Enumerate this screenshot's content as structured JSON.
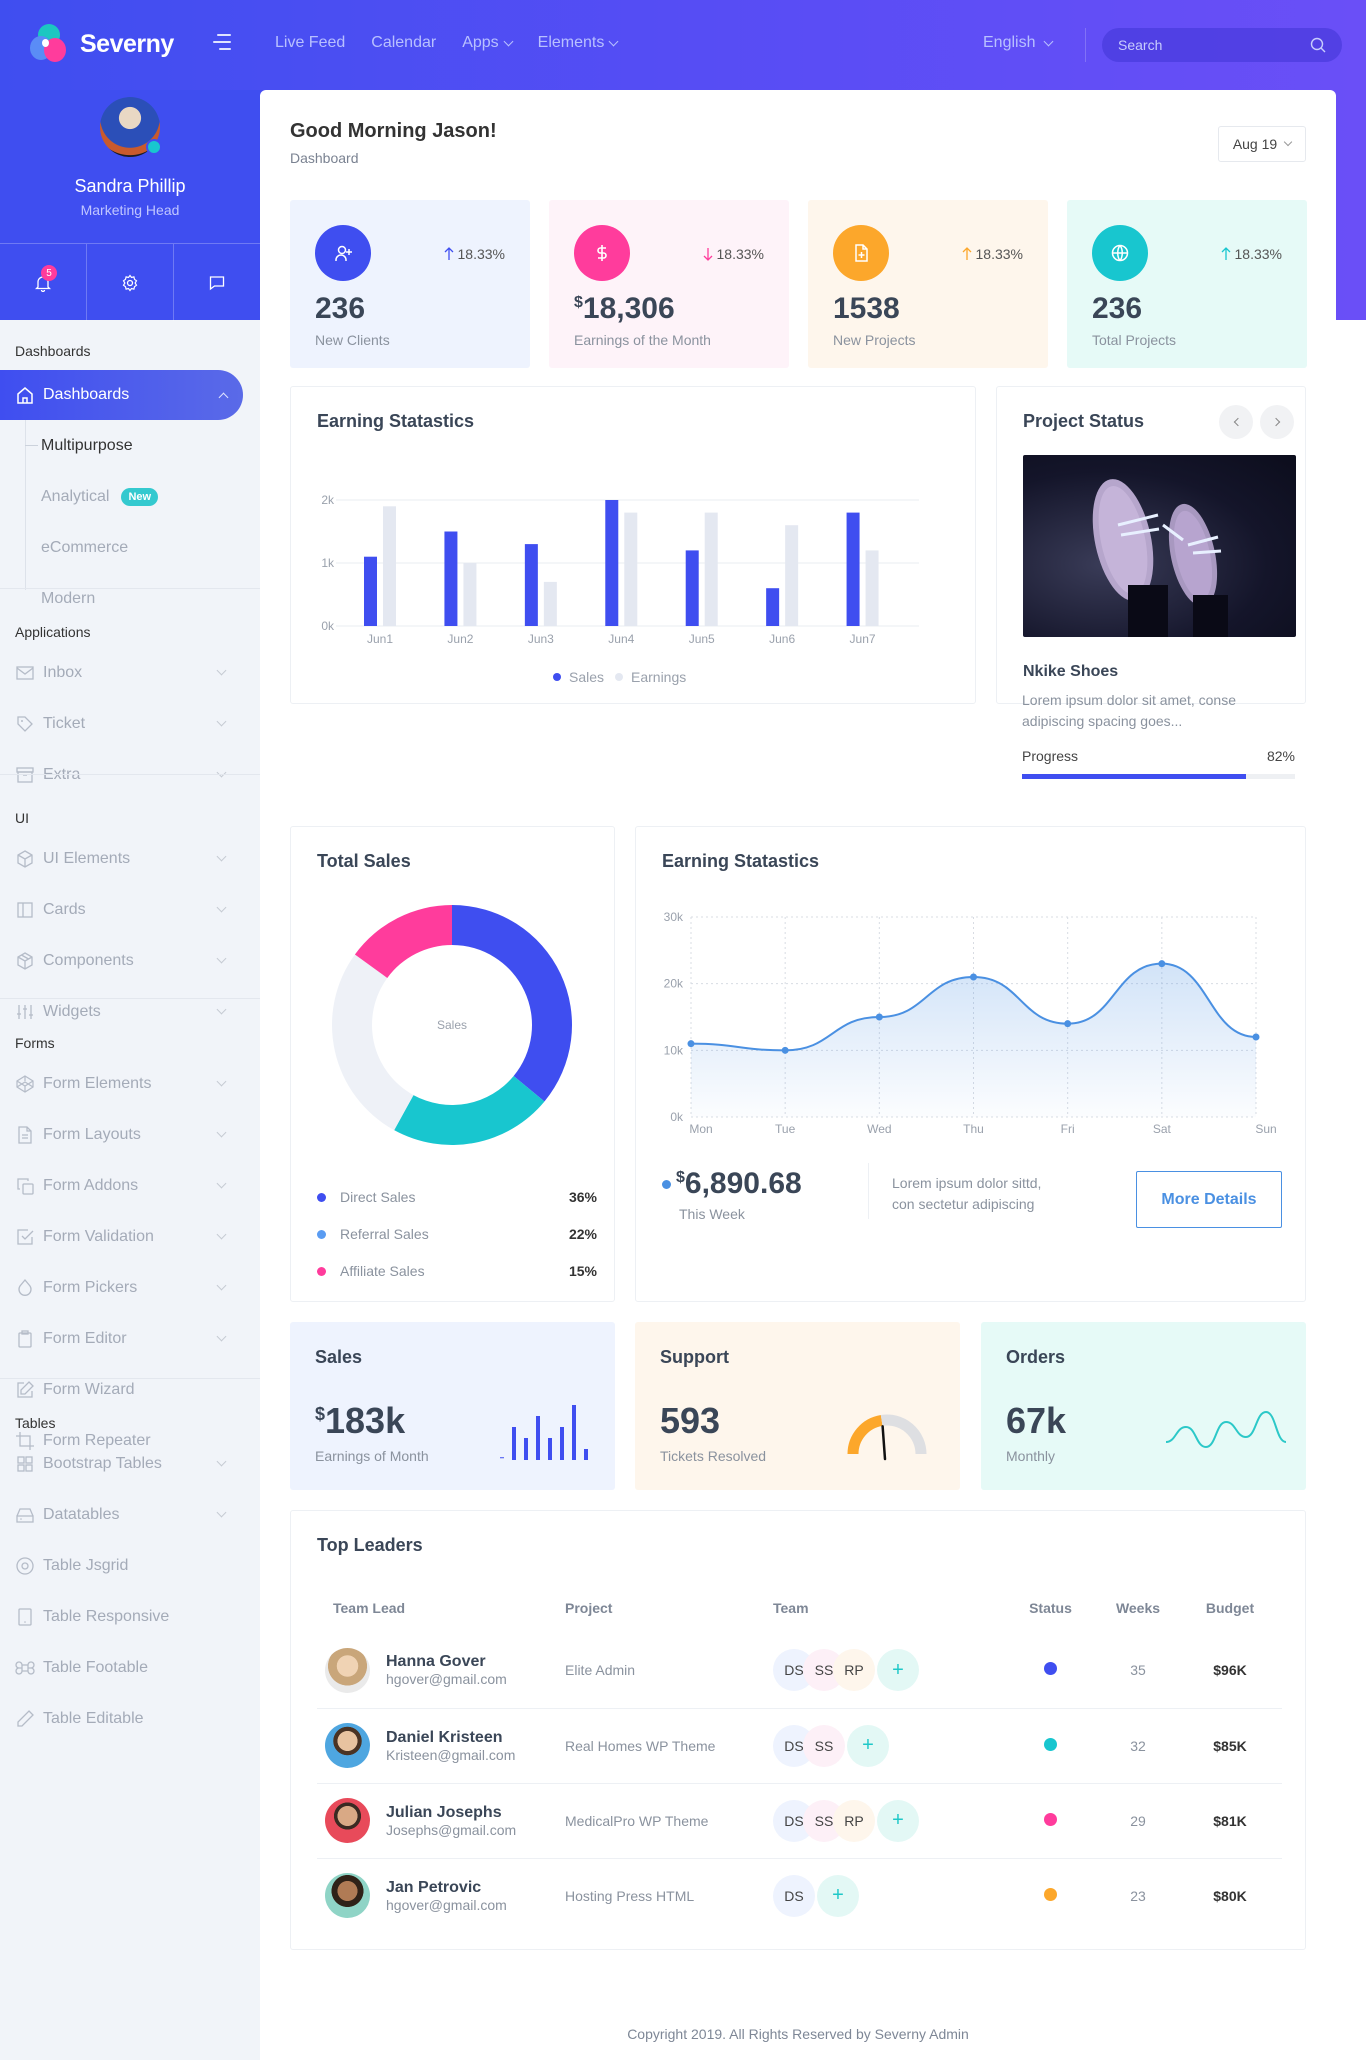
{
  "brand": {
    "name": "Severny",
    "colors": {
      "primary": "#3f4ef0",
      "pink": "#ff3c9c",
      "orange": "#fca72b",
      "teal": "#18c6cf",
      "blue": "#4a90e2"
    }
  },
  "topnav": {
    "items": [
      {
        "label": "Live Feed",
        "dropdown": false
      },
      {
        "label": "Calendar",
        "dropdown": false
      },
      {
        "label": "Apps",
        "dropdown": true
      },
      {
        "label": "Elements",
        "dropdown": true
      }
    ],
    "language": "English",
    "search_placeholder": "Search"
  },
  "profile": {
    "name": "Sandra Phillip",
    "role": "Marketing Head",
    "notifications": "5"
  },
  "sidebar": {
    "dashboards": {
      "title": "Dashboards",
      "active": "Dashboards",
      "sub": [
        {
          "label": "Multipurpose",
          "active": true
        },
        {
          "label": "Analytical",
          "badge": "New"
        },
        {
          "label": "eCommerce"
        },
        {
          "label": "Modern"
        }
      ]
    },
    "applications": {
      "title": "Applications",
      "items": [
        "Inbox",
        "Ticket",
        "Extra"
      ]
    },
    "ui": {
      "title": "UI",
      "items": [
        "UI Elements",
        "Cards",
        "Components",
        "Widgets"
      ]
    },
    "forms": {
      "title": "Forms",
      "items": [
        "Form Elements",
        "Form Layouts",
        "Form Addons",
        "Form Validation",
        "Form Pickers",
        "Form Editor",
        "Form Wizard",
        "Form Repeater"
      ]
    },
    "tables": {
      "title": "Tables",
      "items": [
        "Bootstrap Tables",
        "Datatables",
        "Table Jsgrid",
        "Table Responsive",
        "Table Footable",
        "Table Editable"
      ]
    }
  },
  "page": {
    "greeting": "Good Morning Jason!",
    "breadcrumb": "Dashboard",
    "date_filter": "Aug 19"
  },
  "stats": [
    {
      "value": "236",
      "currency": "",
      "label": "New Clients",
      "trend": "18.33%",
      "direction": "up",
      "icon": "user-plus-icon",
      "color": "#3f4ef0",
      "bg": "#eef3fe"
    },
    {
      "value": "18,306",
      "currency": "$",
      "label": "Earnings of the Month",
      "trend": "18.33%",
      "direction": "down",
      "icon": "dollar-icon",
      "color": "#ff3c9c",
      "bg": "#fef3f9"
    },
    {
      "value": "1538",
      "currency": "",
      "label": "New Projects",
      "trend": "18.33%",
      "direction": "up",
      "icon": "file-plus-icon",
      "color": "#fca72b",
      "bg": "#fef6ec"
    },
    {
      "value": "236",
      "currency": "",
      "label": "Total Projects",
      "trend": "18.33%",
      "direction": "up",
      "icon": "globe-icon",
      "color": "#18c6cf",
      "bg": "#e6faf7"
    }
  ],
  "project_status": {
    "title": "Project Status",
    "product": "Nkike Shoes",
    "description": "Lorem ipsum dolor sit amet, conse adipiscing spacing goes...",
    "progress_label": "Progress",
    "progress": 82,
    "progress_text": "82%"
  },
  "weekly": {
    "amount": "6,890.68",
    "currency": "$",
    "period": "This Week",
    "note_line1": "Lorem ipsum dolor sittd,",
    "note_line2": "con sectetur adipiscing",
    "button": "More Details"
  },
  "minis": {
    "sales": {
      "title": "Sales",
      "currency": "$",
      "value": "183k",
      "label": "Earnings of Month",
      "bars": [
        0.05,
        0.6,
        0.4,
        0.8,
        0.4,
        0.6,
        1.0,
        0.2
      ]
    },
    "support": {
      "title": "Support",
      "value": "593",
      "label": "Tickets Resolved",
      "gauge": 0.45
    },
    "orders": {
      "title": "Orders",
      "value": "67k",
      "label": "Monthly",
      "spark": [
        3,
        6,
        2,
        7,
        4,
        9,
        3
      ]
    }
  },
  "leaders": {
    "title": "Top Leaders",
    "columns": [
      "Team Lead",
      "Project",
      "Team",
      "Status",
      "Weeks",
      "Budget"
    ],
    "rows": [
      {
        "name": "Hanna Gover",
        "email": "hgover@gmail.com",
        "project": "Elite Admin",
        "team": [
          "DS",
          "SS",
          "RP"
        ],
        "status": "#3f4ef0",
        "weeks": "35",
        "budget": "$96K"
      },
      {
        "name": "Daniel Kristeen",
        "email": "Kristeen@gmail.com",
        "project": "Real Homes WP Theme",
        "team": [
          "DS",
          "SS"
        ],
        "status": "#18c6cf",
        "weeks": "32",
        "budget": "$85K"
      },
      {
        "name": "Julian Josephs",
        "email": "Josephs@gmail.com",
        "project": "MedicalPro WP Theme",
        "team": [
          "DS",
          "SS",
          "RP"
        ],
        "status": "#ff3c9c",
        "weeks": "29",
        "budget": "$81K"
      },
      {
        "name": "Jan Petrovic",
        "email": "hgover@gmail.com",
        "project": "Hosting Press HTML",
        "team": [
          "DS"
        ],
        "status": "#fca72b",
        "weeks": "23",
        "budget": "$80K"
      }
    ]
  },
  "footer": "Copyright 2019. All Rights Reserved by Severny Admin",
  "chart_data": [
    {
      "type": "bar",
      "title": "Earning Statastics",
      "categories": [
        "Jun1",
        "Jun2",
        "Jun3",
        "Jun4",
        "Jun5",
        "Jun6",
        "Jun7"
      ],
      "series": [
        {
          "name": "Sales",
          "color": "#3f4ef0",
          "values": [
            1100,
            1500,
            1300,
            2000,
            1200,
            600,
            1800
          ]
        },
        {
          "name": "Earnings",
          "color": "#e4e8f1",
          "values": [
            1900,
            1000,
            700,
            1800,
            1800,
            1600,
            1200
          ]
        }
      ],
      "yticks": [
        "0k",
        "1k",
        "2k"
      ],
      "ylim": [
        0,
        2000
      ],
      "legend": "bottom",
      "grid": true
    },
    {
      "type": "pie",
      "title": "Total Sales",
      "center_label": "Sales",
      "slices": [
        {
          "name": "Direct Sales",
          "value": 36,
          "color": "#3f4ef0",
          "legend_color": "#3f4ef0"
        },
        {
          "name": "Referral Sales",
          "value": 22,
          "color": "#18c6cf",
          "legend_color": "#5a9cf2"
        },
        {
          "name": "Other",
          "value": 27,
          "color": "#eef1f7",
          "legend": false
        },
        {
          "name": "Affiliate Sales",
          "value": 15,
          "color": "#ff3c9c",
          "legend_color": "#ff3c9c"
        }
      ],
      "legend": "bottom"
    },
    {
      "type": "area",
      "title": "Earning Statastics",
      "x": [
        "Mon",
        "Tue",
        "Wed",
        "Thu",
        "Fri",
        "Sat",
        "Sun"
      ],
      "values": [
        11000,
        10000,
        15000,
        21000,
        14000,
        23000,
        12000
      ],
      "yticks": [
        "0k",
        "10k",
        "20k",
        "30k"
      ],
      "ylim": [
        0,
        30000
      ],
      "color": "#4a90e2",
      "grid": true
    }
  ]
}
